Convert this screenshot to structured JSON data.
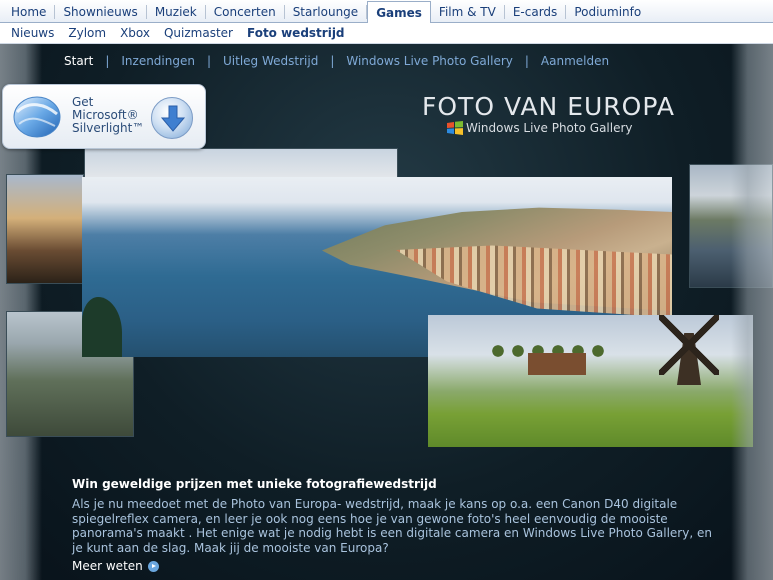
{
  "top_nav": {
    "items": [
      "Home",
      "Shownieuws",
      "Muziek",
      "Concerten",
      "Starlounge",
      "Games",
      "Film & TV",
      "E-cards",
      "Podiuminfo"
    ],
    "active": "Games"
  },
  "sub_nav": {
    "items": [
      "Nieuws",
      "Zylom",
      "Xbox",
      "Quizmaster",
      "Foto wedstrijd"
    ],
    "active": "Foto wedstrijd"
  },
  "contest_nav": {
    "items": [
      "Start",
      "Inzendingen",
      "Uitleg Wedstrijd",
      "Windows Live Photo Gallery",
      "Aanmelden"
    ],
    "active": "Start",
    "separator": "|"
  },
  "silverlight_badge": {
    "line1": "Get",
    "line2": "Microsoft®",
    "line3": "Silverlight™"
  },
  "hero": {
    "title": "FOTO VAN EUROPA",
    "brand_windows_live": "Windows Live",
    "brand_product": "Photo Gallery"
  },
  "info": {
    "heading": "Win geweldige prijzen met unieke fotografiewedstrijd",
    "body": "Als je nu meedoet met de Photo van Europa- wedstrijd, maak je kans op o.a. een Canon D40 digitale spiegelreflex camera, en leer je ook nog eens hoe je van gewone foto's heel eenvoudig de mooiste panorama's maakt . Het enige wat je nodig hebt is een digitale camera en Windows Live Photo Gallery, en je kunt aan de slag. Maak jij de mooiste van Europa?",
    "more_link": "Meer weten"
  }
}
